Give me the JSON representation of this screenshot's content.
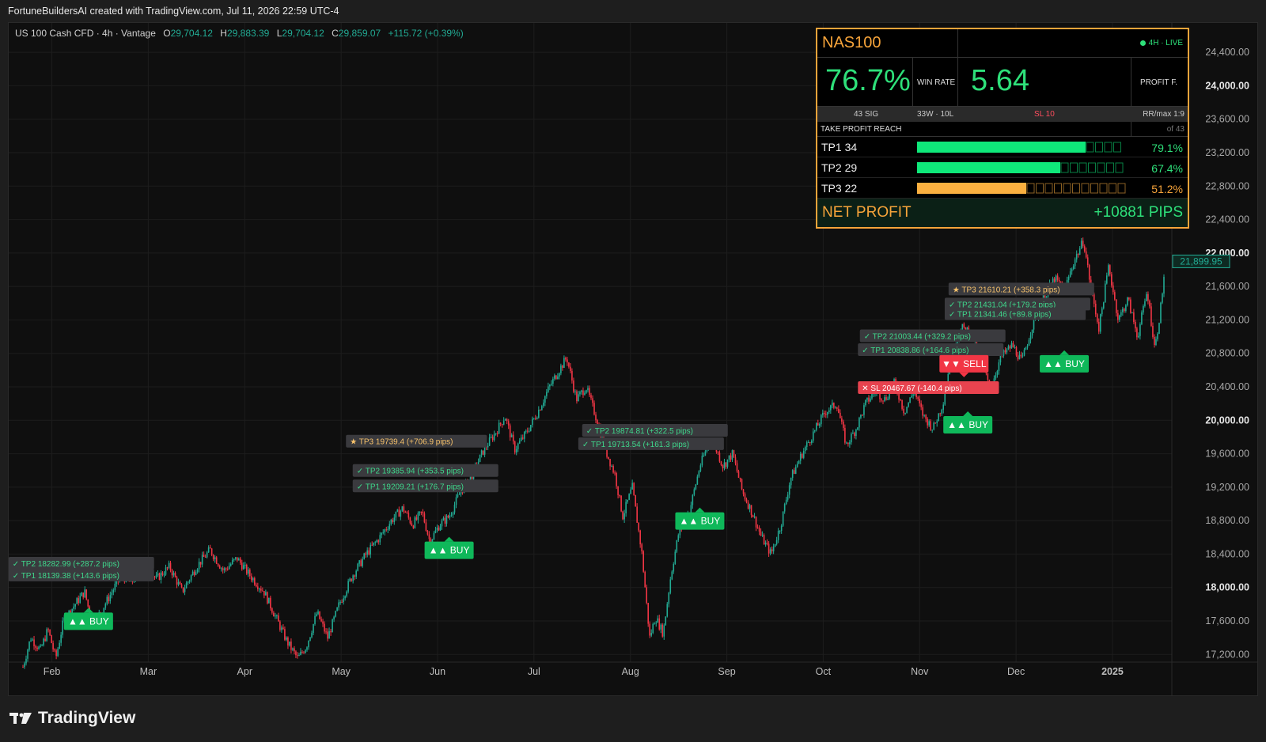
{
  "header": {
    "caption": "FortuneBuildersAI created with TradingView.com, Jul 11, 2026 22:59 UTC-4"
  },
  "legend": {
    "symbol": "US 100 Cash CFD · 4h · Vantage",
    "open_label": "O",
    "open": "29,704.12",
    "high_label": "H",
    "high": "29,883.39",
    "low_label": "L",
    "low": "29,704.12",
    "close_label": "C",
    "close": "29,859.07",
    "change": "+115.72 (+0.39%)"
  },
  "colors": {
    "up": "#22ab94",
    "down": "#f23645",
    "buy": "#0fb85a",
    "sell": "#f23645",
    "panel_border": "#f7a43a",
    "accent_green": "#2ee07a",
    "accent_orange": "#f7a43a",
    "background": "#0f0f0f"
  },
  "stats_panel": {
    "symbol": "NAS100",
    "live": "4H · LIVE",
    "win_rate": "76.7%",
    "win_rate_label": "WIN RATE",
    "profit_factor": "5.64",
    "profit_factor_label": "PROFIT F.",
    "signals": "43 SIG",
    "wins_losses": "33W · 10L",
    "sl": "SL  10",
    "rr": "RR/max  1:9",
    "tp_reach_title": "TAKE PROFIT REACH",
    "tp_reach_of": "of 43",
    "tp_rows": [
      {
        "name": "TP1  34",
        "pct": "79.1%",
        "fill": 0.791,
        "color": "#0fe87a",
        "pct_color": "#2ee07a"
      },
      {
        "name": "TP2  29",
        "pct": "67.4%",
        "fill": 0.674,
        "color": "#0fe87a",
        "pct_color": "#2ee07a"
      },
      {
        "name": "TP3  22",
        "pct": "51.2%",
        "fill": 0.512,
        "color": "#fbb040",
        "pct_color": "#f7a43a"
      }
    ],
    "net_profit_label": "NET PROFIT",
    "net_profit_value": "+10881 PIPS"
  },
  "chart_data": {
    "type": "candlestick",
    "instrument": "US 100 Cash CFD",
    "interval": "4h",
    "ylim": [
      16900,
      24600
    ],
    "y_ticks": [
      {
        "value": 24400,
        "label": "24,400.00"
      },
      {
        "value": 24000,
        "label": "24,000.00"
      },
      {
        "value": 23600,
        "label": "23,600.00"
      },
      {
        "value": 23200,
        "label": "23,200.00"
      },
      {
        "value": 22800,
        "label": "22,800.00"
      },
      {
        "value": 22400,
        "label": "22,400.00"
      },
      {
        "value": 22000,
        "label": "22,000.00"
      },
      {
        "value": 21600,
        "label": "21,600.00"
      },
      {
        "value": 21200,
        "label": "21,200.00"
      },
      {
        "value": 20800,
        "label": "20,800.00"
      },
      {
        "value": 20400,
        "label": "20,400.00"
      },
      {
        "value": 20000,
        "label": "20,000.00"
      },
      {
        "value": 19600,
        "label": "19,600.00"
      },
      {
        "value": 19200,
        "label": "19,200.00"
      },
      {
        "value": 18800,
        "label": "18,800.00"
      },
      {
        "value": 18400,
        "label": "18,400.00"
      },
      {
        "value": 18000,
        "label": "18,000.00"
      },
      {
        "value": 17600,
        "label": "17,600.00"
      },
      {
        "value": 17200,
        "label": "17,200.00"
      }
    ],
    "bold_ticks": [
      24000,
      22000,
      20000,
      18000
    ],
    "last_price": {
      "value": 21899.95,
      "label": "21,899.95"
    },
    "x_ticks": [
      {
        "t": 0.5,
        "label": "Feb"
      },
      {
        "t": 1.5,
        "label": "Mar"
      },
      {
        "t": 2.5,
        "label": "Apr"
      },
      {
        "t": 3.5,
        "label": "May"
      },
      {
        "t": 4.5,
        "label": "Jun"
      },
      {
        "t": 5.5,
        "label": "Jul"
      },
      {
        "t": 6.5,
        "label": "Aug"
      },
      {
        "t": 7.5,
        "label": "Sep"
      },
      {
        "t": 8.5,
        "label": "Oct"
      },
      {
        "t": 9.5,
        "label": "Nov"
      },
      {
        "t": 10.5,
        "label": "Dec"
      },
      {
        "t": 11.5,
        "label": "2025"
      }
    ],
    "x_range": [
      0.2,
      12.05
    ],
    "price_path": [
      [
        0.2,
        17050
      ],
      [
        0.28,
        17400
      ],
      [
        0.38,
        17250
      ],
      [
        0.46,
        17500
      ],
      [
        0.54,
        17150
      ],
      [
        0.62,
        17600
      ],
      [
        0.74,
        17800
      ],
      [
        0.84,
        17950
      ],
      [
        0.92,
        17550
      ],
      [
        1.0,
        17700
      ],
      [
        1.1,
        17900
      ],
      [
        1.22,
        18150
      ],
      [
        1.32,
        18050
      ],
      [
        1.45,
        18300
      ],
      [
        1.58,
        18100
      ],
      [
        1.72,
        18250
      ],
      [
        1.85,
        17950
      ],
      [
        2.0,
        18250
      ],
      [
        2.14,
        18450
      ],
      [
        2.28,
        18200
      ],
      [
        2.42,
        18350
      ],
      [
        2.55,
        18150
      ],
      [
        2.7,
        17950
      ],
      [
        2.82,
        17650
      ],
      [
        2.94,
        17350
      ],
      [
        3.05,
        17150
      ],
      [
        3.14,
        17300
      ],
      [
        3.25,
        17700
      ],
      [
        3.36,
        17400
      ],
      [
        3.48,
        17800
      ],
      [
        3.62,
        18150
      ],
      [
        3.76,
        18400
      ],
      [
        3.9,
        18600
      ],
      [
        4.02,
        18800
      ],
      [
        4.14,
        18950
      ],
      [
        4.24,
        18750
      ],
      [
        4.34,
        18900
      ],
      [
        4.42,
        18550
      ],
      [
        4.52,
        18750
      ],
      [
        4.62,
        18850
      ],
      [
        4.74,
        19150
      ],
      [
        4.86,
        19350
      ],
      [
        4.98,
        19650
      ],
      [
        5.1,
        19850
      ],
      [
        5.2,
        20050
      ],
      [
        5.3,
        19650
      ],
      [
        5.42,
        19850
      ],
      [
        5.54,
        20100
      ],
      [
        5.66,
        20400
      ],
      [
        5.76,
        20600
      ],
      [
        5.84,
        20750
      ],
      [
        5.94,
        20250
      ],
      [
        6.04,
        20400
      ],
      [
        6.14,
        20050
      ],
      [
        6.24,
        19650
      ],
      [
        6.34,
        19350
      ],
      [
        6.42,
        18850
      ],
      [
        6.52,
        19200
      ],
      [
        6.62,
        18400
      ],
      [
        6.7,
        17400
      ],
      [
        6.76,
        17650
      ],
      [
        6.84,
        17450
      ],
      [
        6.92,
        18150
      ],
      [
        7.0,
        18650
      ],
      [
        7.12,
        18950
      ],
      [
        7.22,
        19450
      ],
      [
        7.34,
        19800
      ],
      [
        7.46,
        19450
      ],
      [
        7.56,
        19600
      ],
      [
        7.66,
        19150
      ],
      [
        7.76,
        18900
      ],
      [
        7.86,
        18600
      ],
      [
        7.96,
        18400
      ],
      [
        8.06,
        18750
      ],
      [
        8.16,
        19300
      ],
      [
        8.28,
        19600
      ],
      [
        8.4,
        19850
      ],
      [
        8.52,
        20100
      ],
      [
        8.64,
        20200
      ],
      [
        8.74,
        19700
      ],
      [
        8.84,
        19900
      ],
      [
        8.94,
        20200
      ],
      [
        9.04,
        20350
      ],
      [
        9.14,
        20250
      ],
      [
        9.24,
        20450
      ],
      [
        9.34,
        20100
      ],
      [
        9.44,
        20350
      ],
      [
        9.54,
        20050
      ],
      [
        9.64,
        19900
      ],
      [
        9.74,
        20200
      ],
      [
        9.84,
        20850
      ],
      [
        9.94,
        21100
      ],
      [
        10.04,
        21050
      ],
      [
        10.14,
        20650
      ],
      [
        10.24,
        20400
      ],
      [
        10.34,
        20750
      ],
      [
        10.46,
        20900
      ],
      [
        10.56,
        20700
      ],
      [
        10.66,
        21100
      ],
      [
        10.78,
        21450
      ],
      [
        10.9,
        21700
      ],
      [
        11.0,
        21550
      ],
      [
        11.1,
        21900
      ],
      [
        11.2,
        22150
      ],
      [
        11.28,
        21550
      ],
      [
        11.36,
        21100
      ],
      [
        11.46,
        21850
      ],
      [
        11.56,
        21200
      ],
      [
        11.66,
        21450
      ],
      [
        11.76,
        21000
      ],
      [
        11.86,
        21550
      ],
      [
        11.94,
        20850
      ],
      [
        12.0,
        21350
      ],
      [
        12.05,
        21900
      ]
    ],
    "signals": [
      {
        "t": 0.88,
        "price": 17700,
        "type": "BUY",
        "text": "▲▲ BUY"
      },
      {
        "t": 4.62,
        "price": 18550,
        "type": "BUY",
        "text": "▲▲ BUY"
      },
      {
        "t": 7.22,
        "price": 18900,
        "type": "BUY",
        "text": "▲▲ BUY"
      },
      {
        "t": 10.0,
        "price": 20050,
        "type": "BUY",
        "text": "▲▲ BUY"
      },
      {
        "t": 9.96,
        "price": 20780,
        "type": "SELL",
        "text": "▼▼ SELL"
      },
      {
        "t": 11.0,
        "price": 20780,
        "type": "BUY",
        "text": "▲▲ BUY"
      }
    ],
    "annotations": [
      {
        "t": 0.05,
        "price": 18290,
        "kind": "tp",
        "text": "✓ TP2  18282.99  (+287.2 pips)"
      },
      {
        "t": 0.05,
        "price": 18150,
        "kind": "tp",
        "text": "✓ TP1  18139.38  (+143.6 pips)"
      },
      {
        "t": 3.55,
        "price": 19750,
        "kind": "tp3",
        "text": "★ TP3  19739.4  (+706.9 pips)"
      },
      {
        "t": 3.62,
        "price": 19400,
        "kind": "tp",
        "text": "✓ TP2  19385.94  (+353.5 pips)"
      },
      {
        "t": 3.62,
        "price": 19215,
        "kind": "tp",
        "text": "✓ TP1  19209.21  (+176.7 pips)"
      },
      {
        "t": 6.0,
        "price": 19880,
        "kind": "tp",
        "text": "✓ TP2  19874.81  (+322.5 pips)"
      },
      {
        "t": 5.96,
        "price": 19720,
        "kind": "tp",
        "text": "✓ TP1  19713.54  (+161.3 pips)"
      },
      {
        "t": 8.88,
        "price": 21010,
        "kind": "tp",
        "text": "✓ TP2  21003.44  (+329.2 pips)"
      },
      {
        "t": 8.86,
        "price": 20845,
        "kind": "tp",
        "text": "✓ TP1  20838.86  (+164.6 pips)"
      },
      {
        "t": 8.86,
        "price": 20390,
        "kind": "sl",
        "text": "✕ SL  20467.67  (-140.4 pips)"
      },
      {
        "t": 9.8,
        "price": 21570,
        "kind": "tp3",
        "text": "★ TP3  21610.21  (+358.3 pips)"
      },
      {
        "t": 9.76,
        "price": 21390,
        "kind": "tp",
        "text": "✓ TP2  21431.04  (+179.2 pips)"
      },
      {
        "t": 9.76,
        "price": 21275,
        "kind": "tp",
        "text": "✓ TP1  21341.46  (+89.8 pips)"
      }
    ]
  },
  "footer": {
    "brand": "TradingView"
  }
}
